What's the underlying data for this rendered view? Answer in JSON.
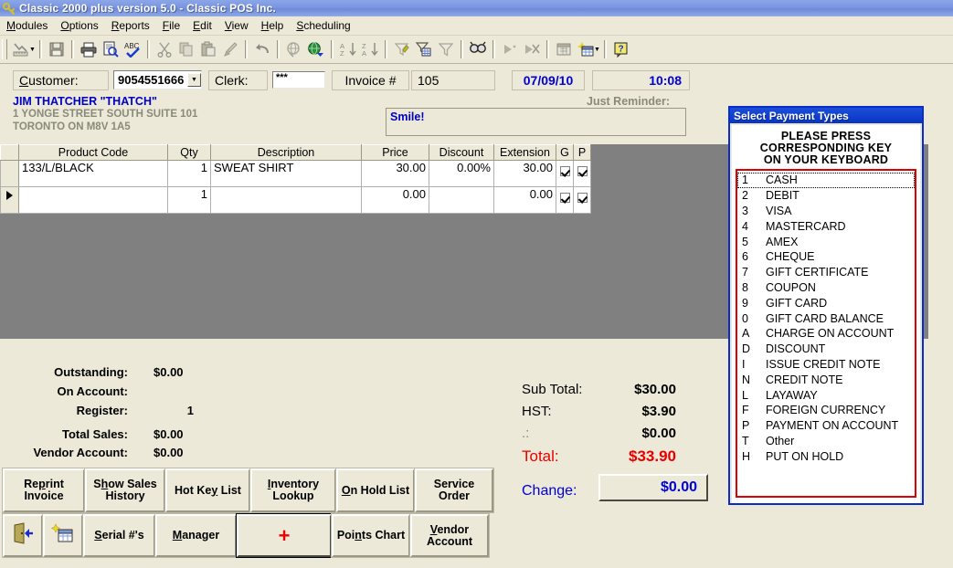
{
  "window": {
    "title": "Classic 2000 plus version 5.0 - Classic POS Inc.",
    "icon": "key-icon"
  },
  "menubar": {
    "items": [
      {
        "label": "Modules",
        "accel": "M"
      },
      {
        "label": "Options",
        "accel": "O"
      },
      {
        "label": "Reports",
        "accel": "R"
      },
      {
        "label": "File",
        "accel": "F"
      },
      {
        "label": "Edit",
        "accel": "E"
      },
      {
        "label": "View",
        "accel": "V"
      },
      {
        "label": "Help",
        "accel": "H"
      },
      {
        "label": "Scheduling",
        "accel": "S"
      }
    ]
  },
  "toolbar": {
    "icons": [
      "design-chart-icon",
      "save-icon",
      "print-icon",
      "print-preview-icon",
      "spellcheck-icon",
      "cut-icon",
      "copy-icon",
      "paste-icon",
      "format-painter-icon",
      "undo-icon",
      "hyperlink-icon",
      "web-icon",
      "sort-ascending-icon",
      "sort-descending-icon",
      "autofilter-icon",
      "filter-grid-icon",
      "filter-icon",
      "find-icon",
      "run-icon",
      "stop-run-icon",
      "new-object-icon",
      "new-table-wizard-icon",
      "help-icon"
    ]
  },
  "header": {
    "customer_label": "Customer:",
    "customer_label_accel": "C",
    "customer_value": "9054551666",
    "clerk_label": "Clerk:",
    "clerk_value": "***",
    "invoice_label": "Invoice #",
    "invoice_value": "105",
    "date_value": "07/09/10",
    "time_value": "10:08",
    "customer_name": "JIM THATCHER \"THATCH\"",
    "customer_address_1": "1 YONGE STREET SOUTH  SUITE 101",
    "customer_address_2": "TORONTO   ON   M8V 1A5",
    "reminder_label": "Just Reminder:",
    "reminder_value": "Smile!"
  },
  "grid": {
    "columns": [
      "",
      "Product Code",
      "Qty",
      "Description",
      "Price",
      "Discount",
      "Extension",
      "G",
      "P"
    ],
    "rows": [
      {
        "marker": "",
        "product_code": "133/L/BLACK",
        "qty": "1",
        "description": "SWEAT SHIRT",
        "price": "30.00",
        "discount": "0.00%",
        "extension": "30.00",
        "g_checked": true,
        "p_checked": true
      },
      {
        "marker": "current-row-arrow",
        "product_code": "",
        "qty": "1",
        "description": "",
        "price": "0.00",
        "discount": "",
        "extension": "0.00",
        "g_checked": true,
        "p_checked": true
      }
    ]
  },
  "summary_left": {
    "rows": [
      {
        "label": "Outstanding:",
        "value": "$0.00"
      },
      {
        "label": "On Account:",
        "value": ""
      },
      {
        "label": "Register:",
        "value": "1"
      },
      {
        "label": "Total Sales:",
        "value": "$0.00"
      },
      {
        "label": "Vendor Account:",
        "value": "$0.00"
      }
    ]
  },
  "summary_right": {
    "sub_total_label": "Sub Total:",
    "sub_total_value": "$30.00",
    "hst_label": "HST:",
    "hst_value": "$3.90",
    "other_label": ".:",
    "other_value": "$0.00",
    "total_label": "Total:",
    "total_value": "$33.90",
    "change_label": "Change:",
    "change_value": "$0.00"
  },
  "buttons_row1": [
    {
      "name": "reprint-invoice",
      "line1": "Re",
      "accel": "p",
      "line1b": "rint",
      "line2": "Invoice",
      "text": "Reprint Invoice"
    },
    {
      "name": "show-sales-history",
      "text": "Show Sales History"
    },
    {
      "name": "hot-key-list",
      "text": "Hot Key List"
    },
    {
      "name": "inventory-lookup",
      "text": "Inventory Lookup"
    },
    {
      "name": "on-hold-list",
      "text": "On Hold List"
    },
    {
      "name": "service-order",
      "text": "Service Order"
    }
  ],
  "buttons_row2": [
    {
      "name": "exit",
      "text": "",
      "icon": "exit-door-icon"
    },
    {
      "name": "new-record",
      "text": "",
      "icon": "new-table-icon"
    },
    {
      "name": "serial-numbers",
      "text": "Serial #'s"
    },
    {
      "name": "manager",
      "text": "Manager"
    },
    {
      "name": "add-item",
      "text": "+",
      "icon": "plus-icon"
    },
    {
      "name": "points-chart",
      "text": "Points Chart"
    },
    {
      "name": "vendor-account",
      "text": "Vendor Account"
    }
  ],
  "payment_dialog": {
    "title": "Select Payment Types",
    "instruction_line1": "PLEASE PRESS",
    "instruction_line2": "CORRESPONDING KEY",
    "instruction_line3": "ON YOUR KEYBOARD",
    "items": [
      {
        "key": "1",
        "name": "CASH",
        "focused": true
      },
      {
        "key": "2",
        "name": "DEBIT",
        "focused": false
      },
      {
        "key": "3",
        "name": "VISA",
        "focused": false
      },
      {
        "key": "4",
        "name": "MASTERCARD",
        "focused": false
      },
      {
        "key": "5",
        "name": "AMEX",
        "focused": false
      },
      {
        "key": "6",
        "name": "CHEQUE",
        "focused": false
      },
      {
        "key": "7",
        "name": "GIFT CERTIFICATE",
        "focused": false
      },
      {
        "key": "8",
        "name": "COUPON",
        "focused": false
      },
      {
        "key": "9",
        "name": "GIFT CARD",
        "focused": false
      },
      {
        "key": "0",
        "name": "GIFT CARD BALANCE",
        "focused": false
      },
      {
        "key": "A",
        "name": "CHARGE ON ACCOUNT",
        "focused": false
      },
      {
        "key": "D",
        "name": "DISCOUNT",
        "focused": false
      },
      {
        "key": "I",
        "name": "ISSUE CREDIT NOTE",
        "focused": false
      },
      {
        "key": "N",
        "name": "CREDIT NOTE",
        "focused": false
      },
      {
        "key": "L",
        "name": "LAYAWAY",
        "focused": false
      },
      {
        "key": "F",
        "name": "FOREIGN CURRENCY",
        "focused": false
      },
      {
        "key": "P",
        "name": "PAYMENT ON ACCOUNT",
        "focused": false
      },
      {
        "key": "T",
        "name": "Other",
        "focused": false
      },
      {
        "key": "H",
        "name": "PUT ON HOLD",
        "focused": false
      }
    ]
  },
  "colors": {
    "window_face": "#ece9d8",
    "title_blue": "#7b95e0",
    "dialog_blue": "#0a34c4",
    "grid_gray": "#808080",
    "total_red": "#e80000",
    "value_blue": "#0000d8",
    "list_border_red": "#e00000"
  }
}
